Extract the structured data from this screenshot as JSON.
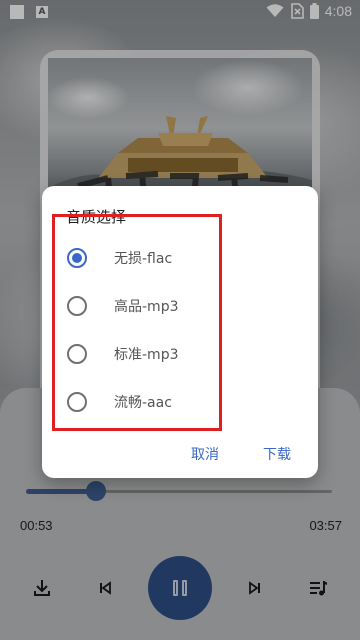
{
  "status_bar": {
    "time": "4:08",
    "icons": [
      "notification-square-icon",
      "a-badge-icon",
      "wifi-icon",
      "no-sim-icon",
      "battery-icon"
    ],
    "a_badge": "A"
  },
  "player": {
    "current_time": "00:53",
    "total_time": "03:57",
    "progress_fraction": 0.23,
    "controls": [
      "download-icon",
      "previous-icon",
      "pause-icon",
      "next-icon",
      "playlist-icon"
    ],
    "accent_color": "#2f4f86"
  },
  "dialog": {
    "title": "音质选择",
    "options": [
      {
        "label": "无损-flac",
        "selected": true
      },
      {
        "label": "高品-mp3",
        "selected": false
      },
      {
        "label": "标准-mp3",
        "selected": false
      },
      {
        "label": "流畅-aac",
        "selected": false
      }
    ],
    "cancel_label": "取消",
    "download_label": "下载",
    "accent_color": "#3a67c9",
    "highlight_color": "#e02020"
  }
}
